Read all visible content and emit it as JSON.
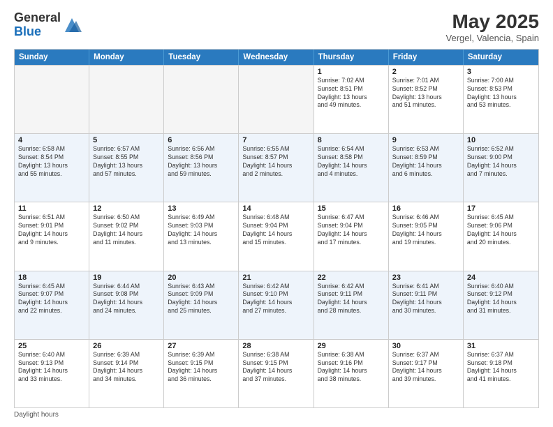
{
  "header": {
    "logo_general": "General",
    "logo_blue": "Blue",
    "month_title": "May 2025",
    "location": "Vergel, Valencia, Spain"
  },
  "days_of_week": [
    "Sunday",
    "Monday",
    "Tuesday",
    "Wednesday",
    "Thursday",
    "Friday",
    "Saturday"
  ],
  "weeks": [
    [
      {
        "day": "",
        "info": "",
        "empty": true
      },
      {
        "day": "",
        "info": "",
        "empty": true
      },
      {
        "day": "",
        "info": "",
        "empty": true
      },
      {
        "day": "",
        "info": "",
        "empty": true
      },
      {
        "day": "1",
        "info": "Sunrise: 7:02 AM\nSunset: 8:51 PM\nDaylight: 13 hours\nand 49 minutes."
      },
      {
        "day": "2",
        "info": "Sunrise: 7:01 AM\nSunset: 8:52 PM\nDaylight: 13 hours\nand 51 minutes."
      },
      {
        "day": "3",
        "info": "Sunrise: 7:00 AM\nSunset: 8:53 PM\nDaylight: 13 hours\nand 53 minutes."
      }
    ],
    [
      {
        "day": "4",
        "info": "Sunrise: 6:58 AM\nSunset: 8:54 PM\nDaylight: 13 hours\nand 55 minutes."
      },
      {
        "day": "5",
        "info": "Sunrise: 6:57 AM\nSunset: 8:55 PM\nDaylight: 13 hours\nand 57 minutes."
      },
      {
        "day": "6",
        "info": "Sunrise: 6:56 AM\nSunset: 8:56 PM\nDaylight: 13 hours\nand 59 minutes."
      },
      {
        "day": "7",
        "info": "Sunrise: 6:55 AM\nSunset: 8:57 PM\nDaylight: 14 hours\nand 2 minutes."
      },
      {
        "day": "8",
        "info": "Sunrise: 6:54 AM\nSunset: 8:58 PM\nDaylight: 14 hours\nand 4 minutes."
      },
      {
        "day": "9",
        "info": "Sunrise: 6:53 AM\nSunset: 8:59 PM\nDaylight: 14 hours\nand 6 minutes."
      },
      {
        "day": "10",
        "info": "Sunrise: 6:52 AM\nSunset: 9:00 PM\nDaylight: 14 hours\nand 7 minutes."
      }
    ],
    [
      {
        "day": "11",
        "info": "Sunrise: 6:51 AM\nSunset: 9:01 PM\nDaylight: 14 hours\nand 9 minutes."
      },
      {
        "day": "12",
        "info": "Sunrise: 6:50 AM\nSunset: 9:02 PM\nDaylight: 14 hours\nand 11 minutes."
      },
      {
        "day": "13",
        "info": "Sunrise: 6:49 AM\nSunset: 9:03 PM\nDaylight: 14 hours\nand 13 minutes."
      },
      {
        "day": "14",
        "info": "Sunrise: 6:48 AM\nSunset: 9:04 PM\nDaylight: 14 hours\nand 15 minutes."
      },
      {
        "day": "15",
        "info": "Sunrise: 6:47 AM\nSunset: 9:04 PM\nDaylight: 14 hours\nand 17 minutes."
      },
      {
        "day": "16",
        "info": "Sunrise: 6:46 AM\nSunset: 9:05 PM\nDaylight: 14 hours\nand 19 minutes."
      },
      {
        "day": "17",
        "info": "Sunrise: 6:45 AM\nSunset: 9:06 PM\nDaylight: 14 hours\nand 20 minutes."
      }
    ],
    [
      {
        "day": "18",
        "info": "Sunrise: 6:45 AM\nSunset: 9:07 PM\nDaylight: 14 hours\nand 22 minutes."
      },
      {
        "day": "19",
        "info": "Sunrise: 6:44 AM\nSunset: 9:08 PM\nDaylight: 14 hours\nand 24 minutes."
      },
      {
        "day": "20",
        "info": "Sunrise: 6:43 AM\nSunset: 9:09 PM\nDaylight: 14 hours\nand 25 minutes."
      },
      {
        "day": "21",
        "info": "Sunrise: 6:42 AM\nSunset: 9:10 PM\nDaylight: 14 hours\nand 27 minutes."
      },
      {
        "day": "22",
        "info": "Sunrise: 6:42 AM\nSunset: 9:11 PM\nDaylight: 14 hours\nand 28 minutes."
      },
      {
        "day": "23",
        "info": "Sunrise: 6:41 AM\nSunset: 9:11 PM\nDaylight: 14 hours\nand 30 minutes."
      },
      {
        "day": "24",
        "info": "Sunrise: 6:40 AM\nSunset: 9:12 PM\nDaylight: 14 hours\nand 31 minutes."
      }
    ],
    [
      {
        "day": "25",
        "info": "Sunrise: 6:40 AM\nSunset: 9:13 PM\nDaylight: 14 hours\nand 33 minutes."
      },
      {
        "day": "26",
        "info": "Sunrise: 6:39 AM\nSunset: 9:14 PM\nDaylight: 14 hours\nand 34 minutes."
      },
      {
        "day": "27",
        "info": "Sunrise: 6:39 AM\nSunset: 9:15 PM\nDaylight: 14 hours\nand 36 minutes."
      },
      {
        "day": "28",
        "info": "Sunrise: 6:38 AM\nSunset: 9:15 PM\nDaylight: 14 hours\nand 37 minutes."
      },
      {
        "day": "29",
        "info": "Sunrise: 6:38 AM\nSunset: 9:16 PM\nDaylight: 14 hours\nand 38 minutes."
      },
      {
        "day": "30",
        "info": "Sunrise: 6:37 AM\nSunset: 9:17 PM\nDaylight: 14 hours\nand 39 minutes."
      },
      {
        "day": "31",
        "info": "Sunrise: 6:37 AM\nSunset: 9:18 PM\nDaylight: 14 hours\nand 41 minutes."
      }
    ]
  ],
  "footer_note": "Daylight hours"
}
